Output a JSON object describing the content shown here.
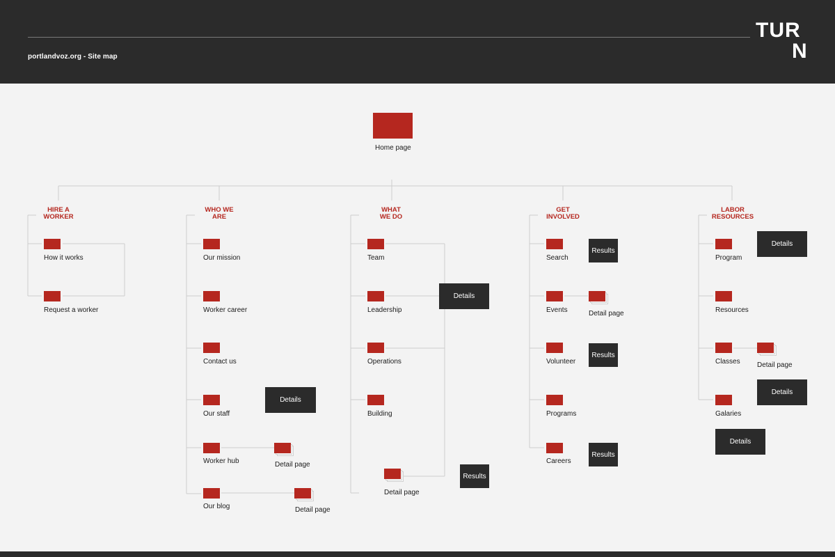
{
  "header": {
    "title": "portlandvoz.org - Site map",
    "logo_line1": "TUR",
    "logo_line2": "N"
  },
  "colors": {
    "accent": "#b5271f",
    "dark": "#2b2b2b",
    "background": "#f3f3f3"
  },
  "root": {
    "label": "Home page"
  },
  "categories": {
    "hire": {
      "line1": "HIRE A",
      "line2": "WORKER",
      "items": [
        "How it works",
        "Request a worker"
      ]
    },
    "who": {
      "line1": "WHO WE",
      "line2": "ARE",
      "items": [
        "Our mission",
        "Worker career",
        "Contact us",
        "Our staff",
        "Worker hub",
        "Our blog"
      ],
      "details": "Details",
      "detail_page_1": "Detail page",
      "detail_page_2": "Detail page"
    },
    "what": {
      "line1": "WHAT",
      "line2": "WE DO",
      "items": [
        "Team",
        "Leadership",
        "Operations",
        "Building"
      ],
      "details": "Details",
      "detail_page": "Detail page",
      "results": "Results"
    },
    "get": {
      "line1": "GET",
      "line2": "INVOLVED",
      "items": [
        "Search",
        "Events",
        "Volunteer",
        "Programs",
        "Careers"
      ],
      "results_1": "Results",
      "detail_page": "Detail page",
      "results_2": "Results",
      "results_3": "Results"
    },
    "labor": {
      "line1": "LABOR",
      "line2": "RESOURCES",
      "items": [
        "Program",
        "Resources",
        "Classes",
        "Galaries"
      ],
      "details_1": "Details",
      "detail_page": "Detail page",
      "details_2": "Details",
      "details_3": "Details"
    }
  }
}
